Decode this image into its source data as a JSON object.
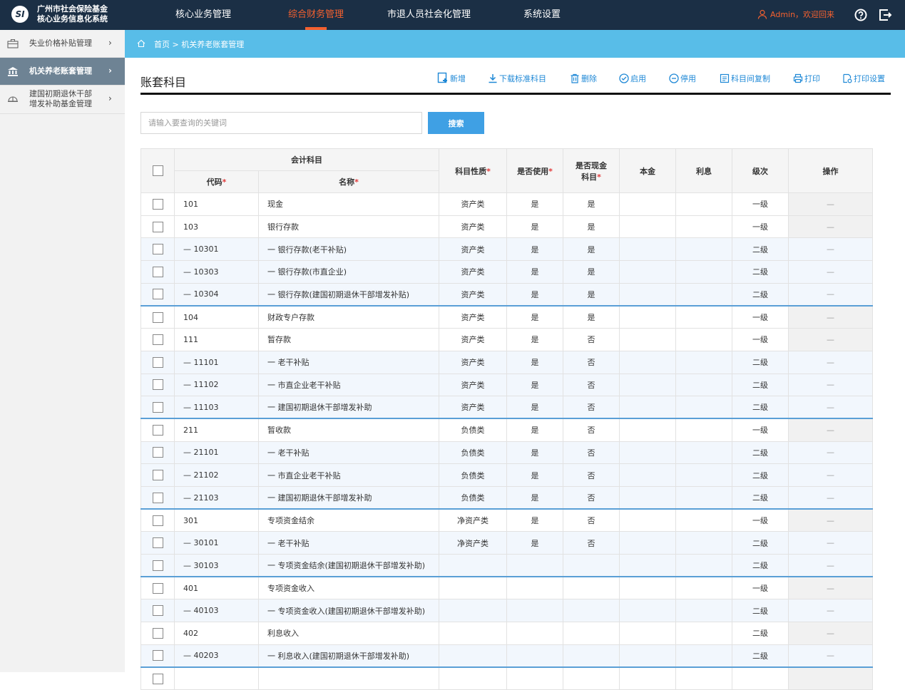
{
  "header": {
    "logo_text": "SI",
    "system_name_line1": "广州市社会保险基金",
    "system_name_line2": "核心业务信息化系统",
    "nav": [
      {
        "label": "核心业务管理"
      },
      {
        "label": "综合财务管理",
        "active": true
      },
      {
        "label": "市退人员社会化管理"
      },
      {
        "label": "系统设置"
      }
    ],
    "user_greeting": "Admin，欢迎回来",
    "accent_color": "#f4602f"
  },
  "sidebar": {
    "items": [
      {
        "label": "失业价格补贴管理",
        "icon": "briefcase-icon"
      },
      {
        "label": "机关养老账套管理",
        "icon": "bank-icon",
        "active": true
      },
      {
        "label_line1": "建国初期退休干部",
        "label_line2": "增发补助基金管理",
        "icon": "helmet-icon"
      }
    ]
  },
  "breadcrumb": {
    "text": "首页 > 机关养老账套管理"
  },
  "page": {
    "title": "账套科目"
  },
  "toolbar": {
    "add": "新增",
    "download": "下载标准科目",
    "delete": "删除",
    "enable": "启用",
    "disable": "停用",
    "copy": "科目间复制",
    "print": "打印",
    "print_settings": "打印设置"
  },
  "search": {
    "placeholder": "请输入要查询的关键词",
    "button": "搜索"
  },
  "table": {
    "group_header": "会计科目",
    "headers": {
      "code": "代码",
      "name": "名称",
      "nature": "科目性质",
      "in_use": "是否使用",
      "is_cash_l1": "是否现金",
      "is_cash_l2": "科目",
      "principal": "本金",
      "interest": "利息",
      "level": "级次",
      "action": "操作"
    },
    "required_mark": "*",
    "rows": [
      {
        "code": "101",
        "name": "现金",
        "nature": "资产类",
        "in_use": "是",
        "is_cash": "是",
        "level": "一级",
        "op": "—",
        "lv": 1,
        "grp": false
      },
      {
        "code": "103",
        "name": "银行存款",
        "nature": "资产类",
        "in_use": "是",
        "is_cash": "是",
        "level": "一级",
        "op": "—",
        "lv": 1,
        "grp": false
      },
      {
        "code": "— 10301",
        "name": "一 银行存款(老干补贴)",
        "nature": "资产类",
        "in_use": "是",
        "is_cash": "是",
        "level": "二级",
        "op": "—",
        "lv": 2,
        "grp": false
      },
      {
        "code": "— 10303",
        "name": "一 银行存款(市直企业)",
        "nature": "资产类",
        "in_use": "是",
        "is_cash": "是",
        "level": "二级",
        "op": "—",
        "lv": 2,
        "grp": false
      },
      {
        "code": "— 10304",
        "name": "一 银行存款(建国初期退休干部增发补贴)",
        "nature": "资产类",
        "in_use": "是",
        "is_cash": "是",
        "level": "二级",
        "op": "—",
        "lv": 2,
        "grp": false
      },
      {
        "code": "104",
        "name": "财政专户存款",
        "nature": "资产类",
        "in_use": "是",
        "is_cash": "是",
        "level": "一级",
        "op": "—",
        "lv": 1,
        "grp": true
      },
      {
        "code": "111",
        "name": "暂存款",
        "nature": "资产类",
        "in_use": "是",
        "is_cash": "否",
        "level": "一级",
        "op": "—",
        "lv": 1,
        "grp": false
      },
      {
        "code": "— 11101",
        "name": "一 老干补贴",
        "nature": "资产类",
        "in_use": "是",
        "is_cash": "否",
        "level": "二级",
        "op": "—",
        "lv": 2,
        "grp": false
      },
      {
        "code": "— 11102",
        "name": "一 市直企业老干补贴",
        "nature": "资产类",
        "in_use": "是",
        "is_cash": "否",
        "level": "二级",
        "op": "—",
        "lv": 2,
        "grp": false
      },
      {
        "code": "— 11103",
        "name": "一 建国初期退休干部增发补助",
        "nature": "资产类",
        "in_use": "是",
        "is_cash": "否",
        "level": "二级",
        "op": "—",
        "lv": 2,
        "grp": false
      },
      {
        "code": "211",
        "name": "暂收款",
        "nature": "负债类",
        "in_use": "是",
        "is_cash": "否",
        "level": "一级",
        "op": "—",
        "lv": 1,
        "grp": true
      },
      {
        "code": "— 21101",
        "name": "一 老干补贴",
        "nature": "负债类",
        "in_use": "是",
        "is_cash": "否",
        "level": "二级",
        "op": "—",
        "lv": 2,
        "grp": false
      },
      {
        "code": "— 21102",
        "name": "一 市直企业老干补贴",
        "nature": "负债类",
        "in_use": "是",
        "is_cash": "否",
        "level": "二级",
        "op": "—",
        "lv": 2,
        "grp": false
      },
      {
        "code": "— 21103",
        "name": "一 建国初期退休干部增发补助",
        "nature": "负债类",
        "in_use": "是",
        "is_cash": "否",
        "level": "二级",
        "op": "—",
        "lv": 2,
        "grp": false
      },
      {
        "code": "301",
        "name": "专项资金结余",
        "nature": "净资产类",
        "in_use": "是",
        "is_cash": "否",
        "level": "一级",
        "op": "—",
        "lv": 1,
        "grp": true
      },
      {
        "code": "— 30101",
        "name": "一 老干补贴",
        "nature": "净资产类",
        "in_use": "是",
        "is_cash": "否",
        "level": "二级",
        "op": "—",
        "lv": 2,
        "grp": false
      },
      {
        "code": "— 30103",
        "name": "一 专项资金结余(建国初期退休干部增发补助)",
        "nature": "",
        "in_use": "",
        "is_cash": "",
        "level": "二级",
        "op": "—",
        "lv": 2,
        "grp": false
      },
      {
        "code": "401",
        "name": "专项资金收入",
        "nature": "",
        "in_use": "",
        "is_cash": "",
        "level": "一级",
        "op": "—",
        "lv": 1,
        "grp": true
      },
      {
        "code": "— 40103",
        "name": "一 专项资金收入(建国初期退休干部增发补助)",
        "nature": "",
        "in_use": "",
        "is_cash": "",
        "level": "二级",
        "op": "—",
        "lv": 2,
        "grp": false
      },
      {
        "code": "402",
        "name": "利息收入",
        "nature": "",
        "in_use": "",
        "is_cash": "",
        "level": "二级",
        "op": "—",
        "lv": 1,
        "grp": false
      },
      {
        "code": "— 40203",
        "name": "一 利息收入(建国初期退休干部增发补助)",
        "nature": "",
        "in_use": "",
        "is_cash": "",
        "level": "二级",
        "op": "—",
        "lv": 2,
        "grp": false
      },
      {
        "code": "",
        "name": "",
        "nature": "",
        "in_use": "",
        "is_cash": "",
        "level": "",
        "op": "",
        "lv": 1,
        "grp": true
      }
    ]
  }
}
